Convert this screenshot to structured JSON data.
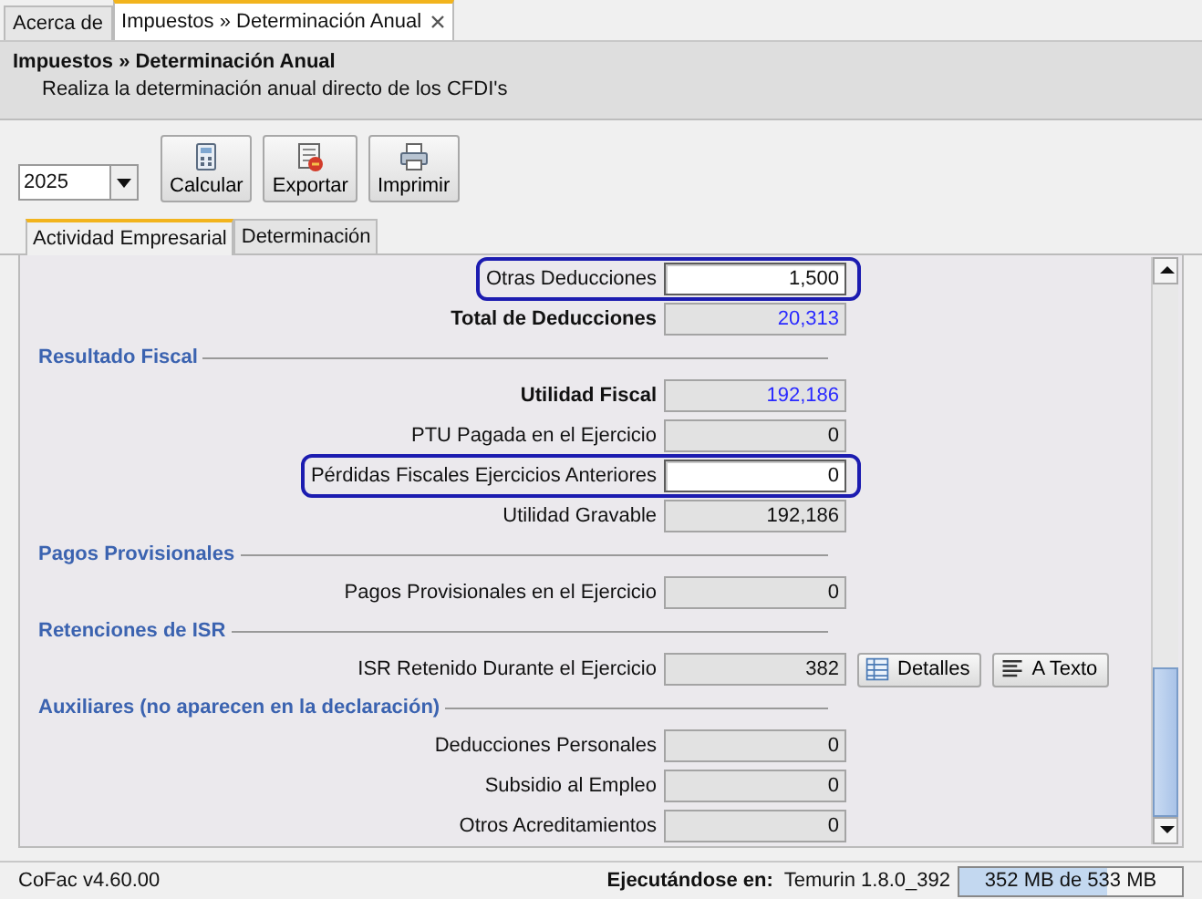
{
  "doc_tabs": [
    {
      "label": "Acerca de",
      "selected": false,
      "closable": false
    },
    {
      "label": "Impuestos » Determinación Anual",
      "selected": true,
      "closable": true
    }
  ],
  "header": {
    "title": "Impuestos » Determinación Anual",
    "subtitle": "Realiza la determinación anual directo de los CFDI's"
  },
  "toolbar": {
    "year": "2025",
    "buttons": [
      {
        "label": "Calcular"
      },
      {
        "label": "Exportar"
      },
      {
        "label": "Imprimir"
      }
    ]
  },
  "tabs": [
    {
      "label": "Actividad Empresarial",
      "selected": true
    },
    {
      "label": "Determinación",
      "selected": false
    }
  ],
  "rows": [
    {
      "kind": "field",
      "label": "Otras Deducciones",
      "value": "1,500",
      "editable": true,
      "bold": false,
      "highlighted": true
    },
    {
      "kind": "field",
      "label": "Total de Deducciones",
      "value": "20,313",
      "editable": false,
      "bold": true,
      "highlighted": false
    },
    {
      "kind": "section",
      "label": "Resultado Fiscal"
    },
    {
      "kind": "field",
      "label": "Utilidad Fiscal",
      "value": "192,186",
      "editable": false,
      "bold": true,
      "highlighted": false
    },
    {
      "kind": "field",
      "label": "PTU Pagada en el Ejercicio",
      "value": "0",
      "editable": false,
      "bold": false,
      "highlighted": false
    },
    {
      "kind": "field",
      "label": "Pérdidas Fiscales Ejercicios Anteriores",
      "value": "0",
      "editable": true,
      "bold": false,
      "highlighted": true
    },
    {
      "kind": "field",
      "label": "Utilidad Gravable",
      "value": "192,186",
      "editable": false,
      "bold": false,
      "highlighted": false
    },
    {
      "kind": "section",
      "label": "Pagos Provisionales"
    },
    {
      "kind": "field",
      "label": "Pagos Provisionales en el Ejercicio",
      "value": "0",
      "editable": false,
      "bold": false,
      "highlighted": false
    },
    {
      "kind": "section",
      "label": "Retenciones de ISR"
    },
    {
      "kind": "field",
      "label": "ISR Retenido Durante el Ejercicio",
      "value": "382",
      "editable": false,
      "bold": false,
      "highlighted": false,
      "buttons": [
        {
          "label": "Detalles"
        },
        {
          "label": "A Texto"
        }
      ]
    },
    {
      "kind": "section",
      "label": "Auxiliares (no aparecen en la declaración)"
    },
    {
      "kind": "field",
      "label": "Deducciones Personales",
      "value": "0",
      "editable": false,
      "bold": false,
      "highlighted": false
    },
    {
      "kind": "field",
      "label": "Subsidio al Empleo",
      "value": "0",
      "editable": false,
      "bold": false,
      "highlighted": false
    },
    {
      "kind": "field",
      "label": "Otros Acreditamientos",
      "value": "0",
      "editable": false,
      "bold": false,
      "highlighted": false
    }
  ],
  "status_bar": {
    "version": "CoFac v4.60.00",
    "runtime_label": "Ejecutándose en:",
    "runtime": "Temurin 1.8.0_392",
    "memory": {
      "text": "352 MB de 533 MB",
      "level": 0.66
    }
  }
}
